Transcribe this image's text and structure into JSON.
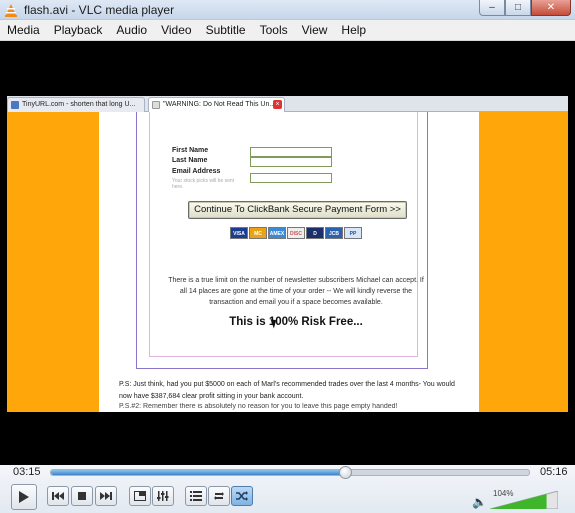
{
  "window": {
    "title": "flash.avi - VLC media player"
  },
  "menu": [
    "Media",
    "Playback",
    "Audio",
    "Video",
    "Subtitle",
    "Tools",
    "View",
    "Help"
  ],
  "browser": {
    "tabs": [
      {
        "label": "TinyURL.com - shorten that long U..."
      },
      {
        "label": "\"WARNING: Do Not Read This Un..."
      }
    ]
  },
  "form": {
    "first_name_label": "First Name",
    "last_name_label": "Last Name",
    "email_label": "Email Address",
    "email_note": "Your stock picks will be sent here.",
    "cta_label": "Continue To ClickBank Secure Payment Form >>",
    "cards": [
      "VISA",
      "MC",
      "AMEX",
      "DISC",
      "D",
      "JCB",
      "PP"
    ]
  },
  "body_text": {
    "limit": "There is a true limit on the number of newsletter subscribers Michael can accept. If all 14 places are gone at the time of your order -- We will kindly reverse the transaction and email you if a space becomes available.",
    "risk_free": "This is 100% Risk Free...",
    "ps": "P.S: Just think, had you put $5000 on each of Marl's recommended trades over the last 4 months- You would now have $387,684 clear profit sitting in your bank account.",
    "ps2": "P.S.#2: Remember there is absolutely no reason for you to leave this page empty handed!"
  },
  "player": {
    "current_time": "03:15",
    "total_time": "05:16",
    "progress": 0.617,
    "volume_label": "104%",
    "volume": 1.04
  },
  "colors": {
    "page_background": "#fea60a",
    "seek_fill": "#3d85c7",
    "volume_fill": "#3fb52b"
  }
}
